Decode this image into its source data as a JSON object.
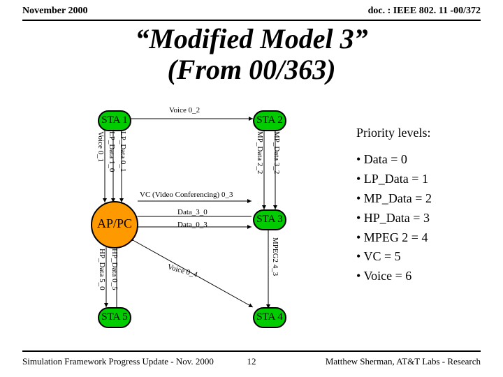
{
  "header": {
    "left": "November 2000",
    "right": "doc. : IEEE 802. 11 -00/372"
  },
  "title": {
    "line1": "“Modified Model 3”",
    "line2": "(From 00/363)"
  },
  "footer": {
    "left": "Simulation Framework Progress Update - Nov. 2000",
    "page": "12",
    "right": "Matthew Sherman, AT&T Labs - Research"
  },
  "legend": {
    "title": "Priority levels:",
    "items": [
      "• Data = 0",
      "• LP_Data = 1",
      "• MP_Data = 2",
      "• HP_Data = 3",
      "• MPEG 2 = 4",
      "• VC = 5",
      "• Voice = 6"
    ]
  },
  "nodes": {
    "ap": "AP/PC",
    "sta1": "STA 1",
    "sta2": "STA 2",
    "sta3": "STA 3",
    "sta4": "STA 4",
    "sta5": "STA 5"
  },
  "edges": {
    "voice02": "Voice 0_2",
    "lpdata01": "LP_Data 0_1",
    "lpdata10": "LP_Data 1_0",
    "voice01": "Voice 0_1",
    "mpdata22": "MP_Data 2_2",
    "mpdata32": "MP_Data 3_2",
    "vc03": "VC (Video Conferencing) 0_3",
    "data30": "Data_3_0",
    "data03": "Data_0_3",
    "mpeg243": "MPEG2 4_3",
    "voice04": "Voice 0_4",
    "hpdata05": "HP_Data 0_5",
    "hpdata50": "HP_Data 5_0"
  }
}
